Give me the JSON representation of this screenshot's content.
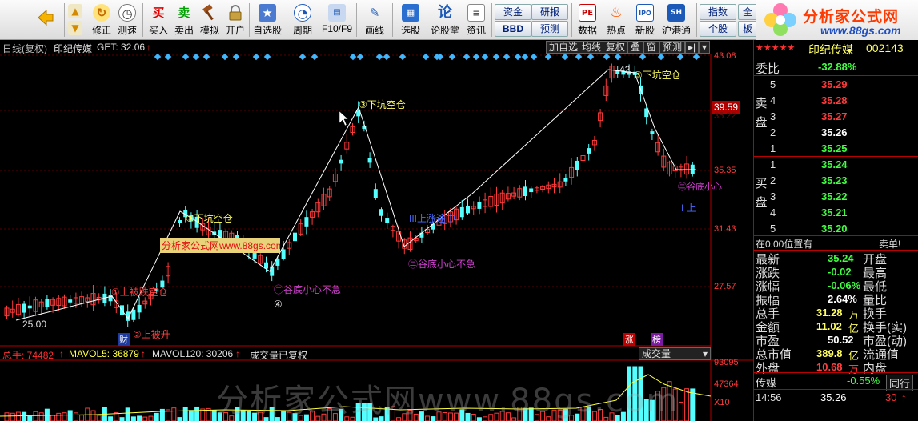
{
  "toolbar": {
    "buttons": [
      {
        "label": "",
        "icon": "back-arrow-icon"
      },
      {
        "label": "修正",
        "icon": "adjust-icon"
      },
      {
        "label": "测速",
        "icon": "speedtest-icon"
      },
      {
        "label": "买入",
        "icon": "buy-icon",
        "glyph": "买"
      },
      {
        "label": "卖出",
        "icon": "sell-icon",
        "glyph": "卖"
      },
      {
        "label": "模拟",
        "icon": "hammer-icon"
      },
      {
        "label": "开户",
        "icon": "lock-icon"
      },
      {
        "label": "自选股",
        "icon": "favorites-icon"
      },
      {
        "label": "周期",
        "icon": "clock-icon"
      },
      {
        "label": "F10/F9",
        "icon": "f10-icon"
      },
      {
        "label": "画线",
        "icon": "pen-icon"
      },
      {
        "label": "选股",
        "icon": "stock-picker-icon"
      },
      {
        "label": "论股堂",
        "icon": "forum-icon",
        "glyph": "论"
      },
      {
        "label": "资讯",
        "icon": "news-icon"
      },
      {
        "label": "数据",
        "icon": "pe-data-icon",
        "glyph": "PE"
      },
      {
        "label": "热点",
        "icon": "hot-icon"
      },
      {
        "label": "新股",
        "icon": "ipo-icon",
        "glyph": "IPO"
      },
      {
        "label": "沪港通",
        "icon": "sh-hk-icon",
        "glyph": "SH"
      }
    ],
    "small_buttons": [
      "资金",
      "研报",
      "BBD",
      "预测",
      "指数",
      "个股",
      "全",
      "板"
    ],
    "logo_text": "分析家公式网",
    "logo_url": "www.88gs.com"
  },
  "chart_header": {
    "period": "日线(复权)",
    "stock_name": "印纪传媒",
    "indicator": "GET: 32.06",
    "up_arrow": "↑",
    "buttons": [
      "加自选",
      "均线",
      "复权",
      "叠",
      "窗",
      "预测"
    ]
  },
  "price_axis": {
    "labels": [
      "43.08",
      "39.59",
      "35.35",
      "31.43",
      "27.57"
    ],
    "current": "39.59",
    "low_mark": "25.00",
    "high_mark": "42",
    "mid_label": "35.22"
  },
  "annotations": [
    {
      "text": "①上被跌空仓",
      "color": "#ff4040"
    },
    {
      "text": "②上被升",
      "color": "#ff4040"
    },
    {
      "text": "③下坑空仓",
      "color": "#ffff60"
    },
    {
      "text": "③下坑空仓",
      "color": "#ffff60"
    },
    {
      "text": "③下坑空仓",
      "color": "#ffff60"
    },
    {
      "text": "㊁谷底小心不急",
      "color": "#d040d0"
    },
    {
      "text": "㊁谷底小心不急",
      "color": "#d040d0"
    },
    {
      "text": "㊁谷底小心",
      "color": "#d040d0"
    },
    {
      "text": "III上涨途中",
      "color": "#4a6bff"
    },
    {
      "text": "I 上",
      "color": "#4a6bff"
    },
    {
      "text": "④",
      "color": "#ffffff"
    },
    {
      "text": "财",
      "color": "#ffffff"
    },
    {
      "text": "涨",
      "color": "#ffffff"
    },
    {
      "text": "榜",
      "color": "#ffffff"
    },
    {
      "text": "分析家公式网www.88gs.com",
      "color": "#ff4040"
    }
  ],
  "volume": {
    "total_label": "总手: 74482",
    "mavol5_label": "MAVOL5: 36879",
    "mavol120_label": "MAVOL120: 30206",
    "note": "成交量已复权",
    "dropdown": "成交量",
    "axis_labels": [
      "93095",
      "47364",
      "X10"
    ]
  },
  "watermark": "分析家公式网www.88gs.com",
  "right_panel": {
    "stock_title": "印纪传媒",
    "stock_code": "002143",
    "stars": "★★★★★",
    "weibi_label": "委比",
    "weibi_value": "-32.88%",
    "sell_side_label": "卖盘",
    "buy_side_label": "买盘",
    "sell_orders": [
      {
        "level": "5",
        "price": "35.29"
      },
      {
        "level": "4",
        "price": "35.28"
      },
      {
        "level": "3",
        "price": "35.27"
      },
      {
        "level": "2",
        "price": "35.26"
      },
      {
        "level": "1",
        "price": "35.25"
      }
    ],
    "buy_orders": [
      {
        "level": "1",
        "price": "35.24"
      },
      {
        "level": "2",
        "price": "35.23"
      },
      {
        "level": "3",
        "price": "35.22"
      },
      {
        "level": "4",
        "price": "35.21"
      },
      {
        "level": "5",
        "price": "35.20"
      }
    ],
    "position_text": "在0.00位置有",
    "sell_one_label": "卖单!",
    "stats": [
      {
        "label": "最新",
        "value": "35.24",
        "color": "#40ff40",
        "label2": "开盘",
        "value2": ""
      },
      {
        "label": "涨跌",
        "value": "-0.02",
        "color": "#40ff40",
        "label2": "最高",
        "value2": ""
      },
      {
        "label": "涨幅",
        "value": "-0.06%",
        "color": "#40ff40",
        "label2": "最低",
        "value2": ""
      },
      {
        "label": "振幅",
        "value": "2.64%",
        "color": "#ffffff",
        "label2": "量比",
        "value2": ""
      },
      {
        "label": "总手",
        "value": "31.28",
        "unit": "万",
        "color": "#ffff60",
        "label2": "换手",
        "value2": ""
      },
      {
        "label": "金额",
        "value": "11.02",
        "unit": "亿",
        "color": "#ffff60",
        "label2": "换手(实)",
        "value2": ""
      },
      {
        "label": "市盈",
        "value": "50.52",
        "color": "#ffffff",
        "label2": "市盈(动)",
        "value2": ""
      },
      {
        "label": "总市值",
        "value": "389.8",
        "unit": "亿",
        "color": "#ffff60",
        "label2": "流通值",
        "value2": ""
      },
      {
        "label": "外盘",
        "value": "10.68",
        "unit": "万",
        "color": "#ff4040",
        "label2": "内盘",
        "value2": ""
      }
    ],
    "sector_name": "传媒",
    "sector_change": "-0.55%",
    "sector_button": "同行",
    "tick_time": "14:56",
    "tick_price": "35.26",
    "tick_volume": "30"
  }
}
